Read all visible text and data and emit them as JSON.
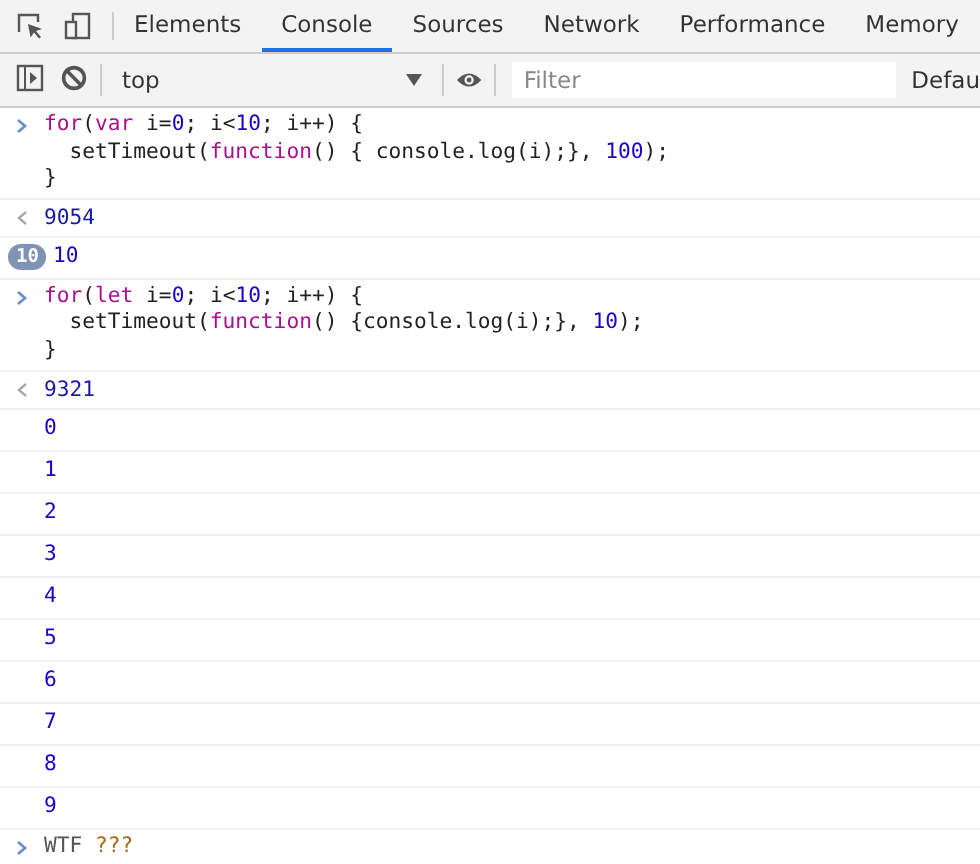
{
  "tabs": [
    {
      "label": "Elements",
      "selected": false
    },
    {
      "label": "Console",
      "selected": true
    },
    {
      "label": "Sources",
      "selected": false
    },
    {
      "label": "Network",
      "selected": false
    },
    {
      "label": "Performance",
      "selected": false
    },
    {
      "label": "Memory",
      "selected": false
    }
  ],
  "toolbar": {
    "context": "top",
    "filter": {
      "placeholder": "Filter"
    },
    "levels": "Defau"
  },
  "console": [
    {
      "kind": "input",
      "lines": [
        [
          {
            "kind": "keyword",
            "text": "for"
          },
          {
            "kind": "plain",
            "text": "("
          },
          {
            "kind": "keyword",
            "text": "var"
          },
          {
            "kind": "plain",
            "text": " i="
          },
          {
            "kind": "number",
            "text": "0"
          },
          {
            "kind": "plain",
            "text": "; i<"
          },
          {
            "kind": "number",
            "text": "10"
          },
          {
            "kind": "plain",
            "text": "; i++) {"
          }
        ],
        [
          {
            "kind": "plain",
            "text": "  setTimeout("
          },
          {
            "kind": "keyword",
            "text": "function"
          },
          {
            "kind": "plain",
            "text": "() { console.log(i);}, "
          },
          {
            "kind": "number",
            "text": "100"
          },
          {
            "kind": "plain",
            "text": ");"
          }
        ],
        [
          {
            "kind": "plain",
            "text": "}"
          }
        ]
      ]
    },
    {
      "kind": "result",
      "text": "9054"
    },
    {
      "kind": "log",
      "count": "10",
      "text": "10"
    },
    {
      "kind": "input",
      "lines": [
        [
          {
            "kind": "keyword",
            "text": "for"
          },
          {
            "kind": "plain",
            "text": "("
          },
          {
            "kind": "keyword",
            "text": "let"
          },
          {
            "kind": "plain",
            "text": " i="
          },
          {
            "kind": "number",
            "text": "0"
          },
          {
            "kind": "plain",
            "text": "; i<"
          },
          {
            "kind": "number",
            "text": "10"
          },
          {
            "kind": "plain",
            "text": "; i++) {"
          }
        ],
        [
          {
            "kind": "plain",
            "text": "  setTimeout("
          },
          {
            "kind": "keyword",
            "text": "function"
          },
          {
            "kind": "plain",
            "text": "() {console.log(i);}, "
          },
          {
            "kind": "number",
            "text": "10"
          },
          {
            "kind": "plain",
            "text": ");"
          }
        ],
        [
          {
            "kind": "plain",
            "text": "}"
          }
        ]
      ]
    },
    {
      "kind": "result",
      "text": "9321"
    },
    {
      "kind": "log",
      "text": "0"
    },
    {
      "kind": "log",
      "text": "1"
    },
    {
      "kind": "log",
      "text": "2"
    },
    {
      "kind": "log",
      "text": "3"
    },
    {
      "kind": "log",
      "text": "4"
    },
    {
      "kind": "log",
      "text": "5"
    },
    {
      "kind": "log",
      "text": "6"
    },
    {
      "kind": "log",
      "text": "7"
    },
    {
      "kind": "log",
      "text": "8"
    },
    {
      "kind": "log",
      "text": "9"
    }
  ],
  "prompt": {
    "tokens": [
      {
        "kind": "plain",
        "text": "WTF "
      },
      {
        "kind": "string",
        "text": "???"
      }
    ]
  }
}
